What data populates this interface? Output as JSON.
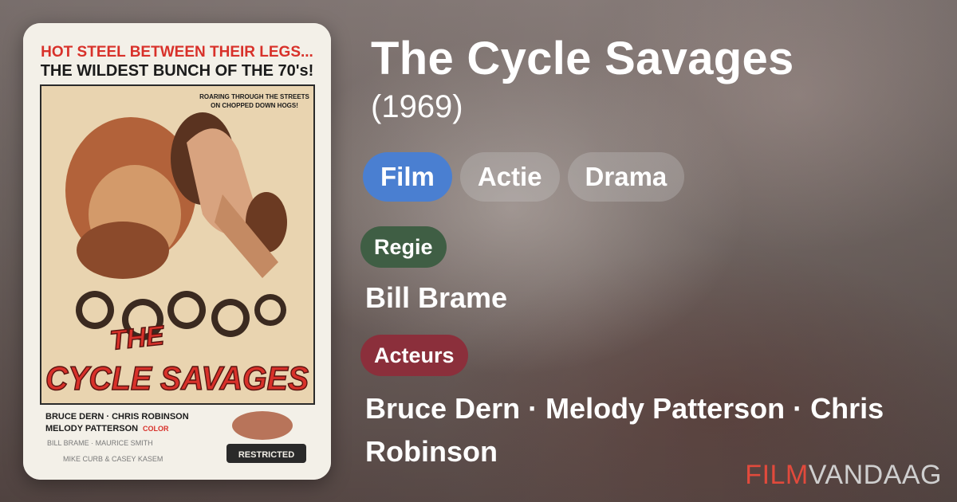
{
  "movie": {
    "title": "The Cycle Savages",
    "year": "(1969)"
  },
  "genres": [
    "Film",
    "Actie",
    "Drama"
  ],
  "credits": {
    "director_label": "Regie",
    "director": "Bill Brame",
    "actors_label": "Acteurs",
    "actors": "Bruce Dern · Melody Patterson · Chris Robinson"
  },
  "poster": {
    "tagline_1": "HOT STEEL BETWEEN THEIR LEGS...",
    "tagline_2": "THE WILDEST BUNCH OF THE 70's!",
    "blurb_1": "ROARING THROUGH THE STREETS",
    "blurb_2": "ON CHOPPED DOWN HOGS!",
    "title_1": "THE",
    "title_2": "CYCLE SAVAGES",
    "cast_1": "BRUCE DERN · CHRIS ROBINSON",
    "cast_2": "MELODY PATTERSON",
    "color": "COLOR",
    "crew_1": "BILL BRAME · MAURICE SMITH",
    "crew_2": "MIKE CURB & CASEY KASEM",
    "rating": "RESTRICTED"
  },
  "brand": {
    "part1": "FILM",
    "part2": "VANDAAG"
  },
  "colors": {
    "pill_primary": "#4a7fd1",
    "regie_tag": "#3f5e44",
    "acteurs_tag": "#8b2f3b",
    "brand_red": "#e14a3c",
    "poster_red": "#d8312a"
  }
}
